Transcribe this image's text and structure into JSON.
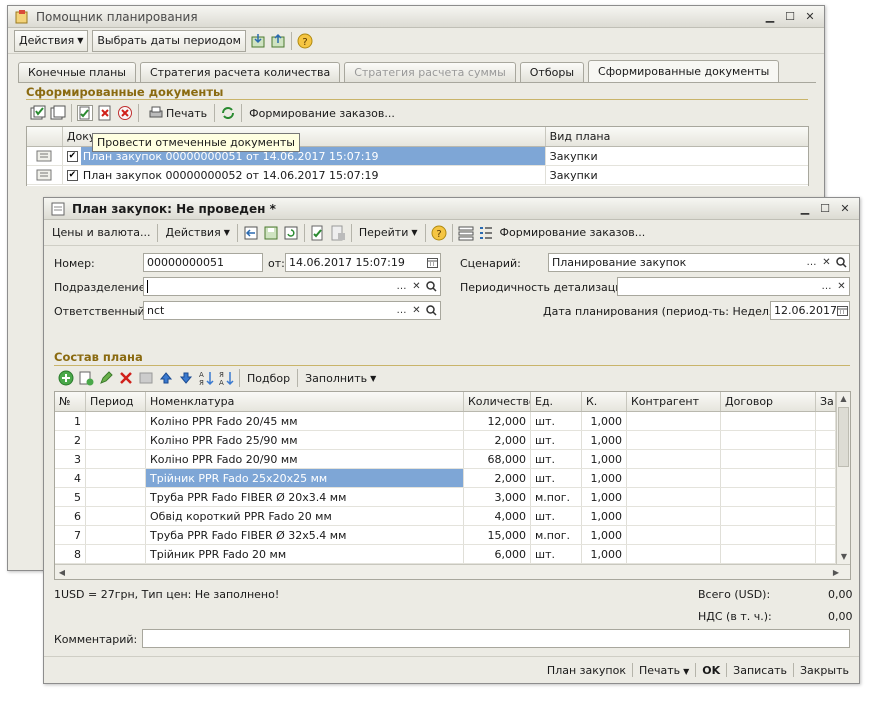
{
  "back_window": {
    "title": "Помощник планирования",
    "toolbar": {
      "actions": "Действия",
      "select_dates": "Выбрать даты периодом"
    },
    "tabs": [
      "Конечные планы",
      "Стратегия расчета количества",
      "Стратегия расчета суммы",
      "Отборы",
      "Сформированные документы"
    ],
    "section_title": "Сформированные документы",
    "doc_toolbar": {
      "print": "Печать",
      "form_orders": "Формирование заказов..."
    },
    "grid": {
      "columns": [
        "Документ",
        "Вид плана"
      ],
      "rows": [
        {
          "doc": "План закупок 00000000051 от 14.06.2017 15:07:19",
          "type": "Закупки"
        },
        {
          "doc": "План закупок 00000000052 от 14.06.2017 15:07:19",
          "type": "Закупки"
        }
      ]
    },
    "tooltip": "Провести отмеченные документы"
  },
  "front_window": {
    "title": "План закупок: Не проведен *",
    "toolbar": {
      "prices": "Цены и валюта...",
      "actions": "Действия",
      "goto": "Перейти",
      "form_orders": "Формирование заказов..."
    },
    "form": {
      "number_label": "Номер:",
      "number_value": "00000000051",
      "date_label": "от:",
      "date_value": "14.06.2017 15:07:19",
      "scenario_label": "Сценарий:",
      "scenario_value": "Планирование закупок",
      "division_label": "Подразделение:",
      "division_value": "",
      "periodicity_label": "Периодичность детализации:",
      "periodicity_value": "",
      "responsible_label": "Ответственный:",
      "responsible_value": "nct",
      "plan_date_label": "Дата планирования (период-ть: Неделя):",
      "plan_date_value": "12.06.2017"
    },
    "section_title": "Состав плана",
    "plan_toolbar": {
      "pick": "Подбор",
      "fill": "Заполнить"
    },
    "table": {
      "columns": [
        "№",
        "Период",
        "Номенклатура",
        "Количество",
        "Ед.",
        "К.",
        "Контрагент",
        "Договор",
        "За"
      ],
      "rows": [
        {
          "n": "1",
          "period": "",
          "item": "Коліно PPR Fado 20/45 мм",
          "qty": "12,000",
          "unit": "шт.",
          "k": "1,000",
          "contractor": "",
          "contract": ""
        },
        {
          "n": "2",
          "period": "",
          "item": "Коліно PPR Fado 25/90 мм",
          "qty": "2,000",
          "unit": "шт.",
          "k": "1,000",
          "contractor": "",
          "contract": ""
        },
        {
          "n": "3",
          "period": "",
          "item": "Коліно PPR Fado 20/90 мм",
          "qty": "68,000",
          "unit": "шт.",
          "k": "1,000",
          "contractor": "",
          "contract": ""
        },
        {
          "n": "4",
          "period": "",
          "item": "Трійник PPR Fado 25х20х25 мм",
          "qty": "2,000",
          "unit": "шт.",
          "k": "1,000",
          "contractor": "",
          "contract": ""
        },
        {
          "n": "5",
          "period": "",
          "item": "Труба PPR Fado FIBER Ø 20х3.4 мм",
          "qty": "3,000",
          "unit": "м.пог.",
          "k": "1,000",
          "contractor": "",
          "contract": ""
        },
        {
          "n": "6",
          "period": "",
          "item": "Обвід короткий PPR Fado 20 мм",
          "qty": "4,000",
          "unit": "шт.",
          "k": "1,000",
          "contractor": "",
          "contract": ""
        },
        {
          "n": "7",
          "period": "",
          "item": "Труба PPR Fado FIBER Ø 32х5.4 мм",
          "qty": "15,000",
          "unit": "м.пог.",
          "k": "1,000",
          "contractor": "",
          "contract": ""
        },
        {
          "n": "8",
          "period": "",
          "item": "Трійник PPR Fado 20 мм",
          "qty": "6,000",
          "unit": "шт.",
          "k": "1,000",
          "contractor": "",
          "contract": ""
        }
      ]
    },
    "footer": {
      "currency_info": "1USD = 27грн, Тип цен: Не заполнено!",
      "total_label": "Всего (USD):",
      "total_value": "0,00",
      "vat_label": "НДС (в т. ч.):",
      "vat_value": "0,00",
      "comment_label": "Комментарий:",
      "comment_value": ""
    },
    "bottom_bar": {
      "plan": "План закупок",
      "print": "Печать",
      "ok": "OK",
      "save": "Записать",
      "close": "Закрыть"
    }
  },
  "colors": {
    "window_bg": "#ecebe4",
    "selection": "#7ea6d6",
    "section_title": "#8a6a10"
  }
}
